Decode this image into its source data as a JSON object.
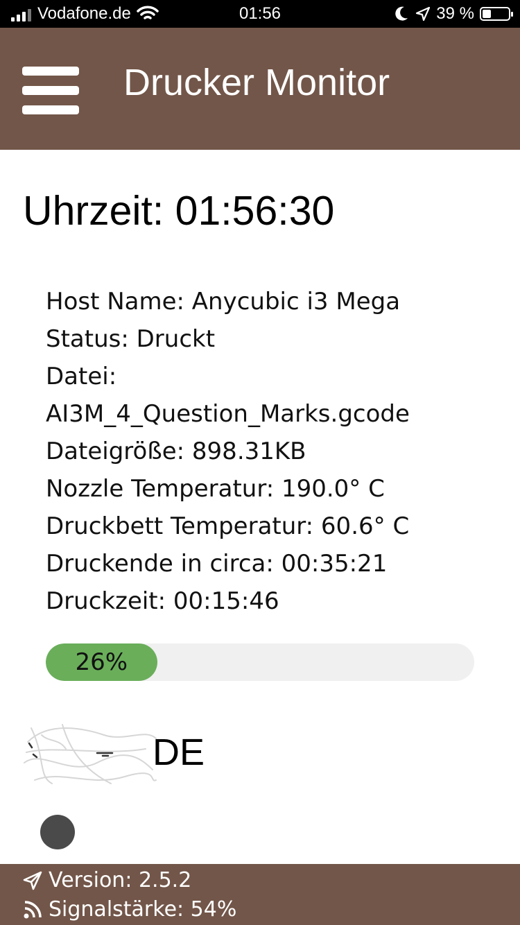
{
  "status_bar": {
    "carrier": "Vodafone.de",
    "time": "01:56",
    "battery": "39 %"
  },
  "header": {
    "title": "Drucker Monitor"
  },
  "clock_text": "Uhrzeit: 01:56:30",
  "printer": {
    "host": "Host Name: Anycubic i3 Mega",
    "status": "Status: Druckt",
    "file_label": "Datei:",
    "file_name": "AI3M_4_Question_Marks.gcode",
    "file_size": "Dateigröße: 898.31KB",
    "nozzle": "Nozzle Temperatur: 190.0° C",
    "bed": "Druckbett Temperatur: 60.6° C",
    "eta": "Druckende in circa: 00:35:21",
    "elapsed": "Druckzeit: 00:15:46"
  },
  "progress": {
    "value": 0.26,
    "label": "26%"
  },
  "country": {
    "code": "DE"
  },
  "footer": {
    "version": "Version: 2.5.2",
    "signal": "Signalstärke: 54%"
  },
  "colors": {
    "brand": "#725649",
    "progress_fill": "#6aae5a",
    "progress_track": "#f0f0f0"
  }
}
